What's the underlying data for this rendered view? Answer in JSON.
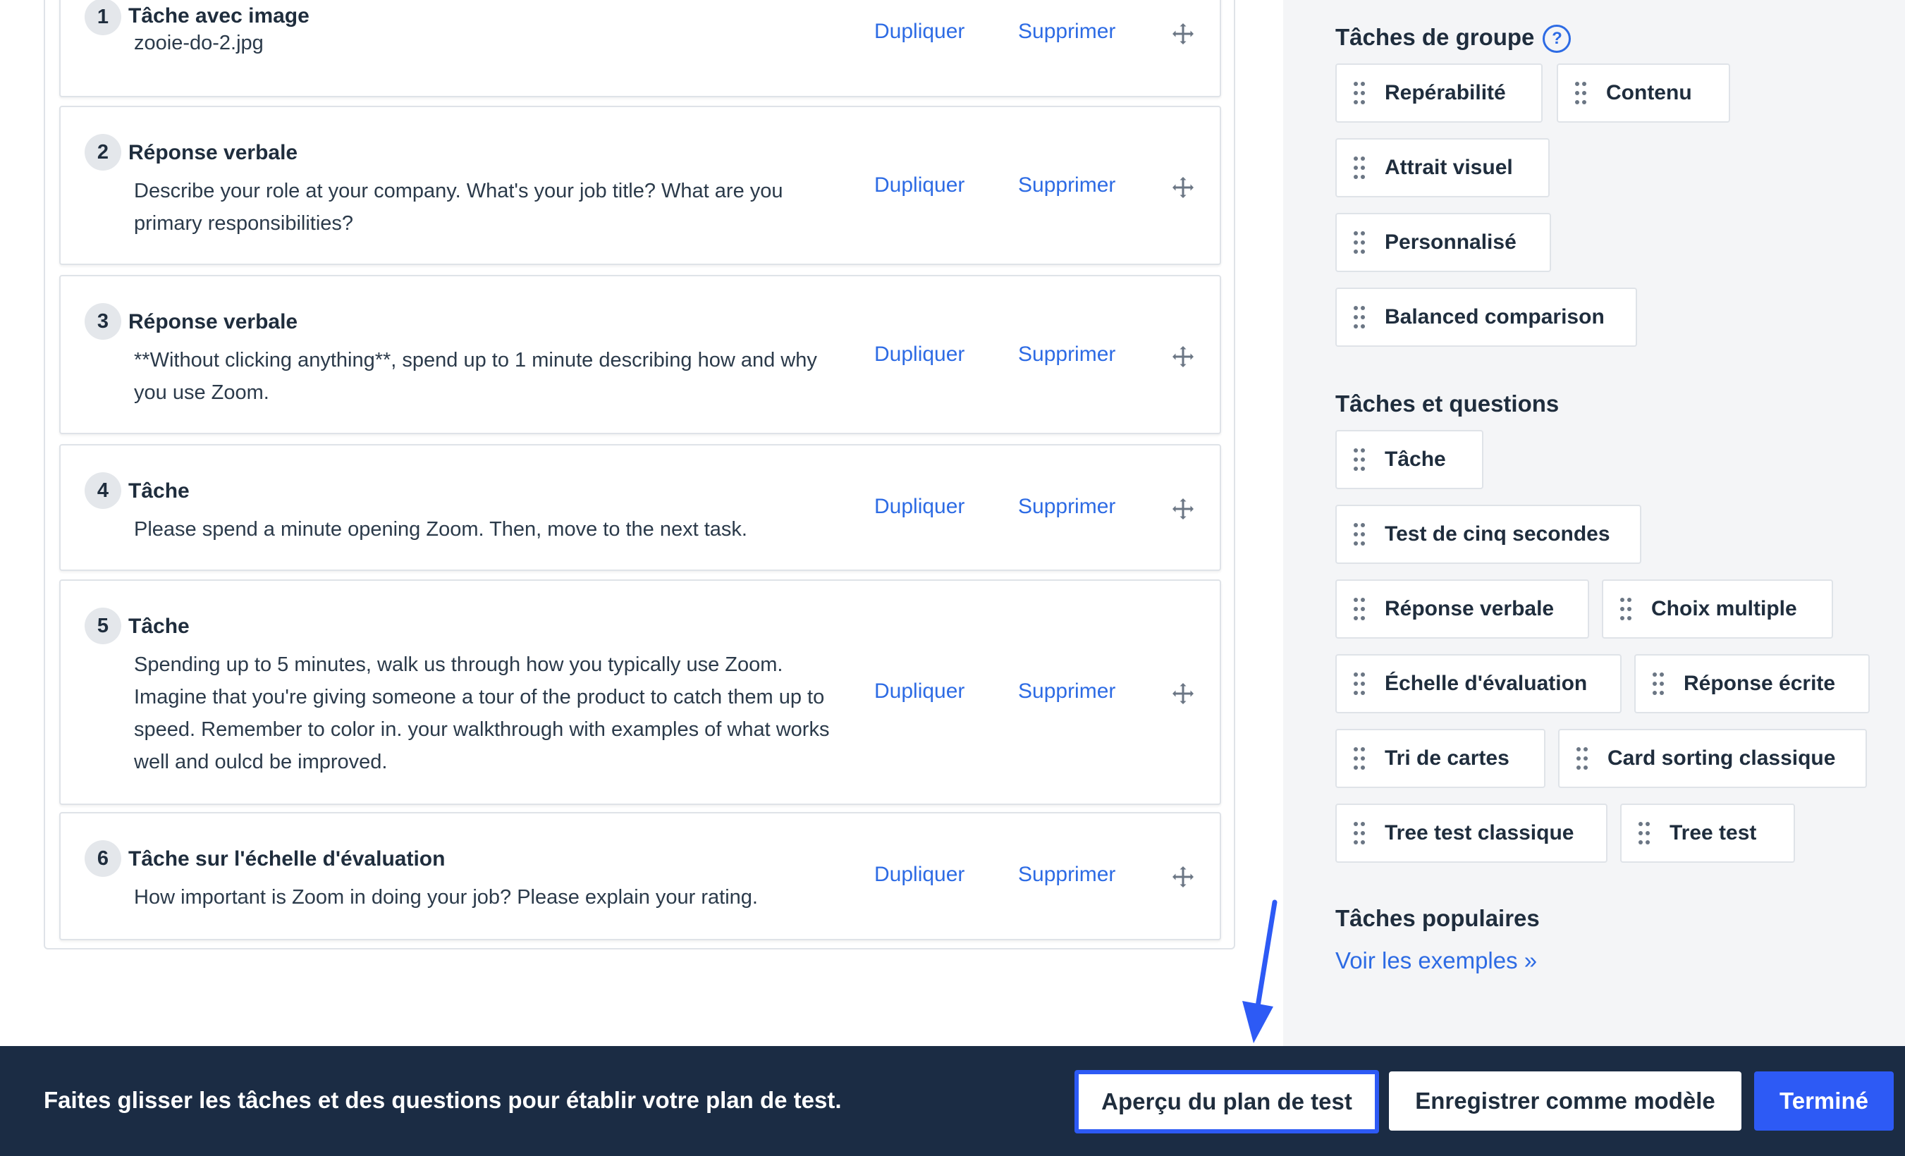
{
  "tasks": [
    {
      "num": "1",
      "title": "Tâche avec image",
      "desc": "zooie-do-2.jpg"
    },
    {
      "num": "2",
      "title": "Réponse verbale",
      "desc": "Describe your role at your company. What's your job title? What are you primary responsibilities?"
    },
    {
      "num": "3",
      "title": "Réponse verbale",
      "desc": "**Without clicking anything**, spend up to 1 minute describing how and why you use Zoom."
    },
    {
      "num": "4",
      "title": "Tâche",
      "desc": "Please spend a minute opening Zoom. Then, move to the next task."
    },
    {
      "num": "5",
      "title": "Tâche",
      "desc": "Spending up to 5 minutes, walk us through how you typically use Zoom. Imagine that you're giving someone a tour of the product to catch them up to speed. Remember to color in. your walkthrough with examples of what works well and oulcd be improved."
    },
    {
      "num": "6",
      "title": "Tâche sur l'échelle d'évaluation",
      "desc": "How important is Zoom in doing your job? Please explain your rating."
    }
  ],
  "actions": {
    "duplicate": "Dupliquer",
    "delete": "Supprimer"
  },
  "sidebar": {
    "group_title": "Tâches de groupe",
    "help_glyph": "?",
    "group_items": [
      "Repérabilité",
      "Contenu",
      "Attrait visuel",
      "Personnalisé",
      "Balanced comparison"
    ],
    "tq_title": "Tâches et questions",
    "tq_items": [
      "Tâche",
      "Test de cinq secondes",
      "Réponse verbale",
      "Choix multiple",
      "Échelle d'évaluation",
      "Réponse écrite",
      "Tri de cartes",
      "Card sorting classique",
      "Tree test classique",
      "Tree test"
    ],
    "popular_title": "Tâches populaires",
    "popular_link": "Voir les exemples »"
  },
  "footer": {
    "text": "Faites glisser les tâches et des questions pour établir votre plan de test.",
    "preview": "Aperçu du plan de test",
    "save_template": "Enregistrer comme modèle",
    "done": "Terminé"
  },
  "colors": {
    "accent": "#2d6be4",
    "primary_button": "#2d5af5",
    "footer_bg": "#1b2c44",
    "sidebar_bg": "#f4f5f7"
  },
  "icons": {
    "drag": "move-arrows-icon",
    "grip": "drag-grip-icon",
    "help": "help-circle-icon",
    "annotation": "arrow-down-icon"
  }
}
